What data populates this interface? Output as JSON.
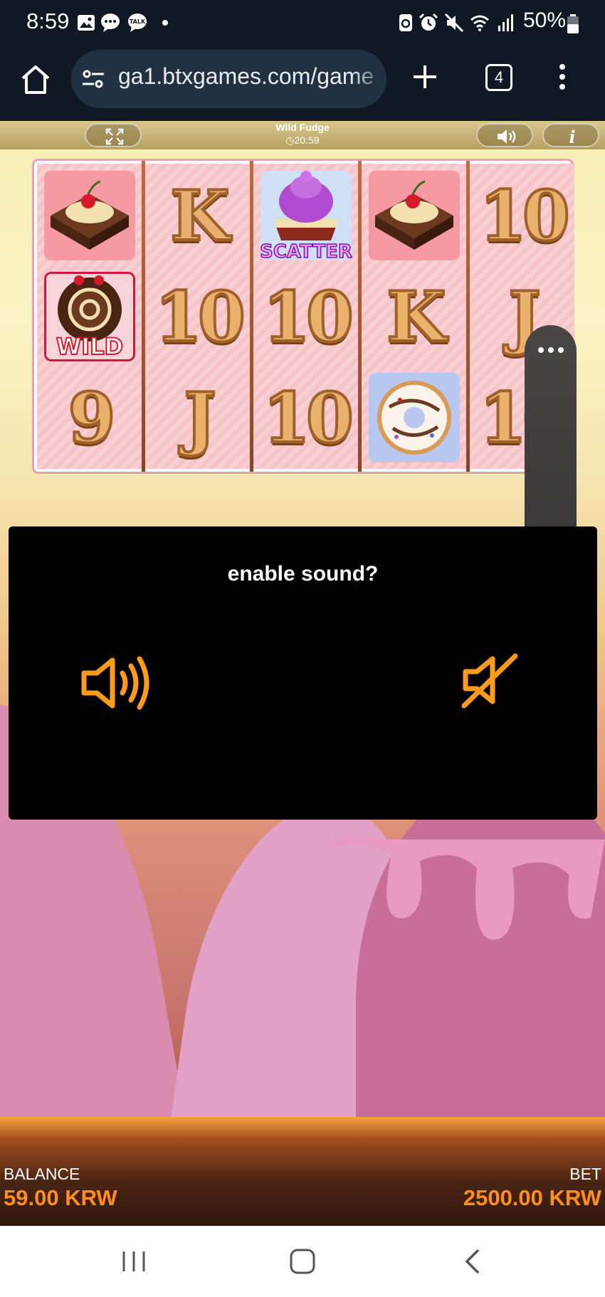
{
  "status_bar": {
    "time": "8:59",
    "battery": "50%",
    "left_icons": [
      "gallery-icon",
      "chat-icon",
      "talk-icon",
      "dot-icon"
    ],
    "right_icons": [
      "sync-icon",
      "alarm-icon",
      "mute-icon",
      "wifi-icon",
      "signal-icon",
      "battery-icon"
    ]
  },
  "browser": {
    "url": "ga1.btxgames.com/game",
    "tab_count": "4"
  },
  "game": {
    "title": "Wild Fudge",
    "clock": "20:59",
    "reels": [
      [
        "cake",
        "wild",
        "9"
      ],
      [
        "K",
        "10",
        "J"
      ],
      [
        "scatter",
        "10",
        "10"
      ],
      [
        "cake",
        "K",
        "donut"
      ],
      [
        "10",
        "J",
        "10"
      ]
    ],
    "scatter_label": "SCATTER",
    "wild_label": "WILD"
  },
  "sound_dialog": {
    "title": "enable sound?"
  },
  "footer": {
    "balance_label": "BALANCE",
    "balance_value": "59.00 KRW",
    "bet_label": "BET",
    "bet_value": "2500.00 KRW"
  },
  "colors": {
    "accent": "#ff8f1a",
    "dialog_bg": "#000000",
    "status_bg": "#0f1824"
  }
}
